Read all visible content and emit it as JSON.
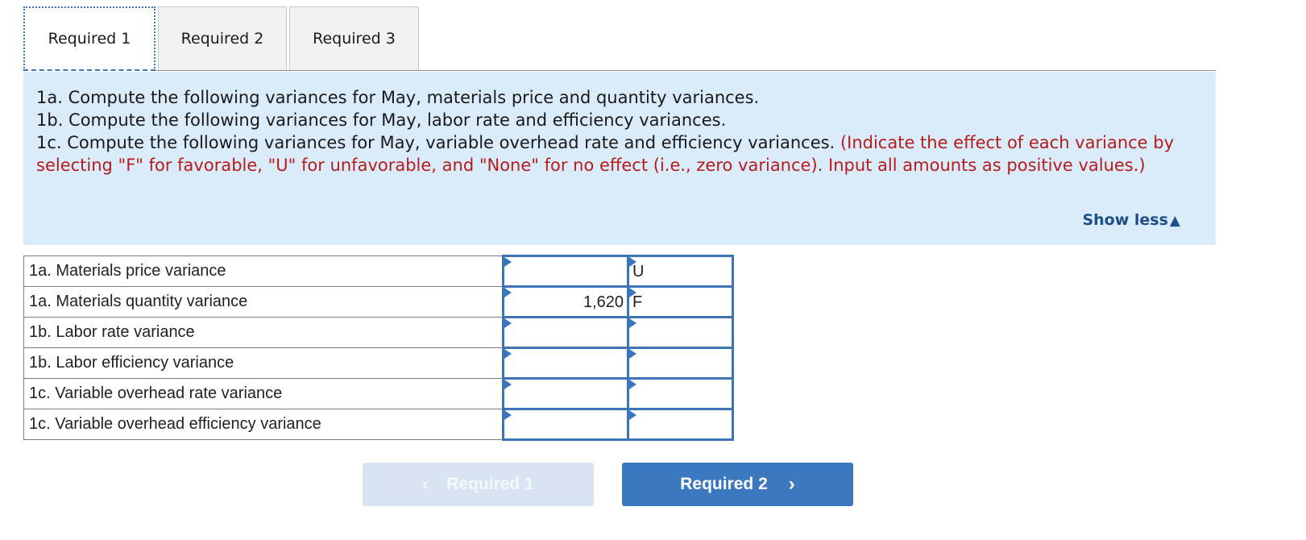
{
  "tabs": [
    {
      "label": "Required 1",
      "active": true
    },
    {
      "label": "Required 2",
      "active": false
    },
    {
      "label": "Required 3",
      "active": false
    }
  ],
  "instructions": {
    "line_1a": "1a. Compute the following variances for May, materials price and quantity variances.",
    "line_1b": "1b. Compute the following variances for May, labor rate and efficiency variances.",
    "line_1c": "1c. Compute the following variances for May, variable overhead rate and efficiency variances.",
    "note": "(Indicate the effect of each variance by selecting \"F\" for favorable, \"U\" for unfavorable, and \"None\" for no effect (i.e., zero variance). Input all amounts as positive values.)",
    "show_less_label": "Show less",
    "show_less_icon": "triangle-up-icon"
  },
  "table": {
    "rows": [
      {
        "label": "1a. Materials price variance",
        "amount": "",
        "effect": "U"
      },
      {
        "label": "1a. Materials quantity variance",
        "amount": "1,620",
        "effect": "F"
      },
      {
        "label": "1b. Labor rate variance",
        "amount": "",
        "effect": ""
      },
      {
        "label": "1b. Labor efficiency variance",
        "amount": "",
        "effect": ""
      },
      {
        "label": "1c. Variable overhead rate variance",
        "amount": "",
        "effect": ""
      },
      {
        "label": "1c. Variable overhead efficiency variance",
        "amount": "",
        "effect": ""
      }
    ]
  },
  "navigation": {
    "prev_label": "Required 1",
    "next_label": "Required 2",
    "prev_icon": "‹",
    "next_icon": "›"
  },
  "colors": {
    "accent": "#3b78be",
    "instruction_bg": "#daebf9",
    "note_red": "#b71c1c",
    "link_blue": "#1e4e8c"
  }
}
